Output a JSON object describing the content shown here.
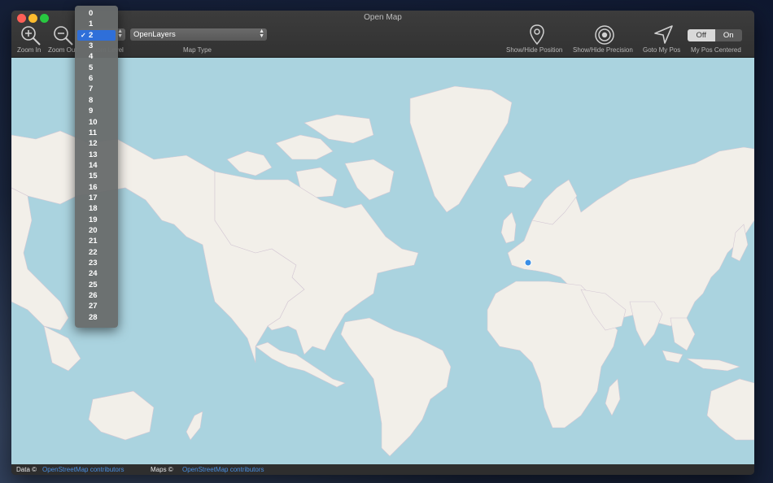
{
  "window": {
    "title": "Open Map"
  },
  "toolbar": {
    "zoom_in_label": "Zoom In",
    "zoom_out_label": "Zoom Out",
    "zoom_level_label": "Zoom Level",
    "zoom_level_value": "2",
    "map_type_label": "Map Type",
    "map_type_value": "OpenLayers",
    "show_hide_position_label": "Show/Hide Position",
    "show_hide_precision_label": "Show/Hide Precision",
    "goto_my_pos_label": "Goto My Pos",
    "my_pos_centered_label": "My Pos Centered",
    "toggle_off": "Off",
    "toggle_on": "On",
    "toggle_selected": "Off"
  },
  "zoom_menu": {
    "selected": "2",
    "items": [
      "0",
      "1",
      "2",
      "3",
      "4",
      "5",
      "6",
      "7",
      "8",
      "9",
      "10",
      "11",
      "12",
      "13",
      "14",
      "15",
      "16",
      "17",
      "18",
      "19",
      "20",
      "21",
      "22",
      "23",
      "24",
      "25",
      "26",
      "27",
      "28"
    ]
  },
  "footer": {
    "data_label": "Data ©",
    "data_link": "OpenStreetMap contributors",
    "maps_label": "Maps ©",
    "maps_link": "OpenStreetMap contributors"
  },
  "colors": {
    "water": "#aad3df",
    "land": "#f2efe9",
    "border": "#c9a4c9",
    "position_marker": "#3a8ee6",
    "menu_highlight": "#2f6fd9"
  },
  "icons": [
    "zoom-in-icon",
    "zoom-out-icon",
    "location-pin-icon",
    "target-icon",
    "navigation-arrow-icon"
  ]
}
